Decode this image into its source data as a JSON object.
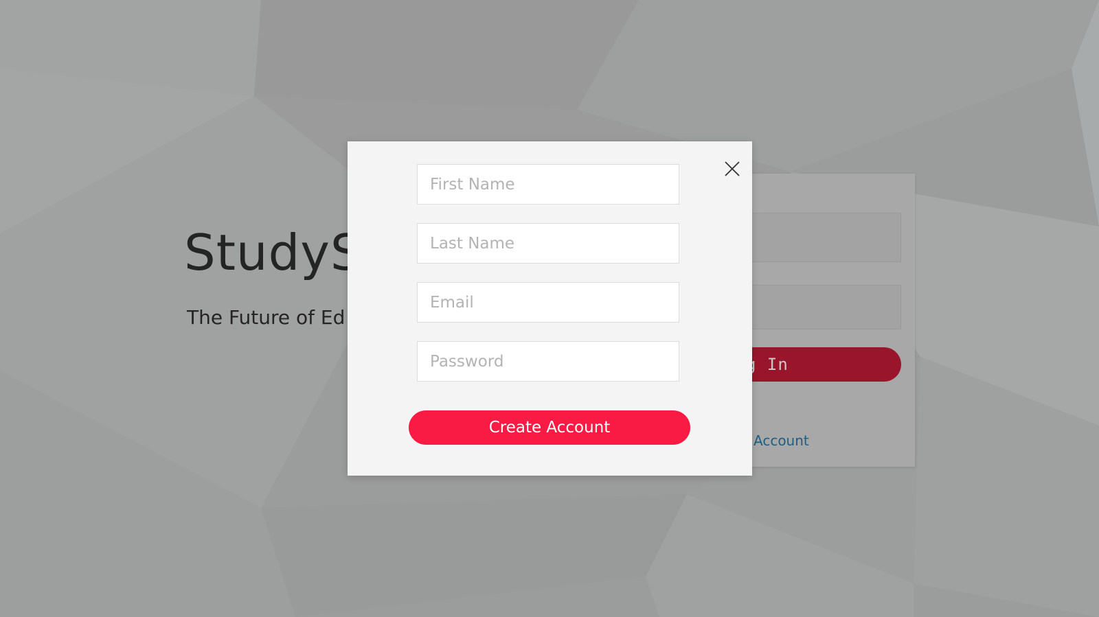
{
  "background": {
    "brand_title": "StudyS",
    "brand_tagline": "The Future of Ed"
  },
  "login_card": {
    "sign_in_label": "g In",
    "create_account_link": "Account"
  },
  "signup_modal": {
    "first_name": {
      "value": "",
      "placeholder": "First Name"
    },
    "last_name": {
      "value": "",
      "placeholder": "Last Name"
    },
    "email": {
      "value": "",
      "placeholder": "Email"
    },
    "password": {
      "value": "",
      "placeholder": "Password"
    },
    "submit_label": "Create Account",
    "close_icon": "close-icon"
  },
  "colors": {
    "accent": "#fa1b44",
    "dimmed_accent": "#99152b",
    "link": "#1d5f82",
    "modal_bg": "#f4f4f4"
  }
}
